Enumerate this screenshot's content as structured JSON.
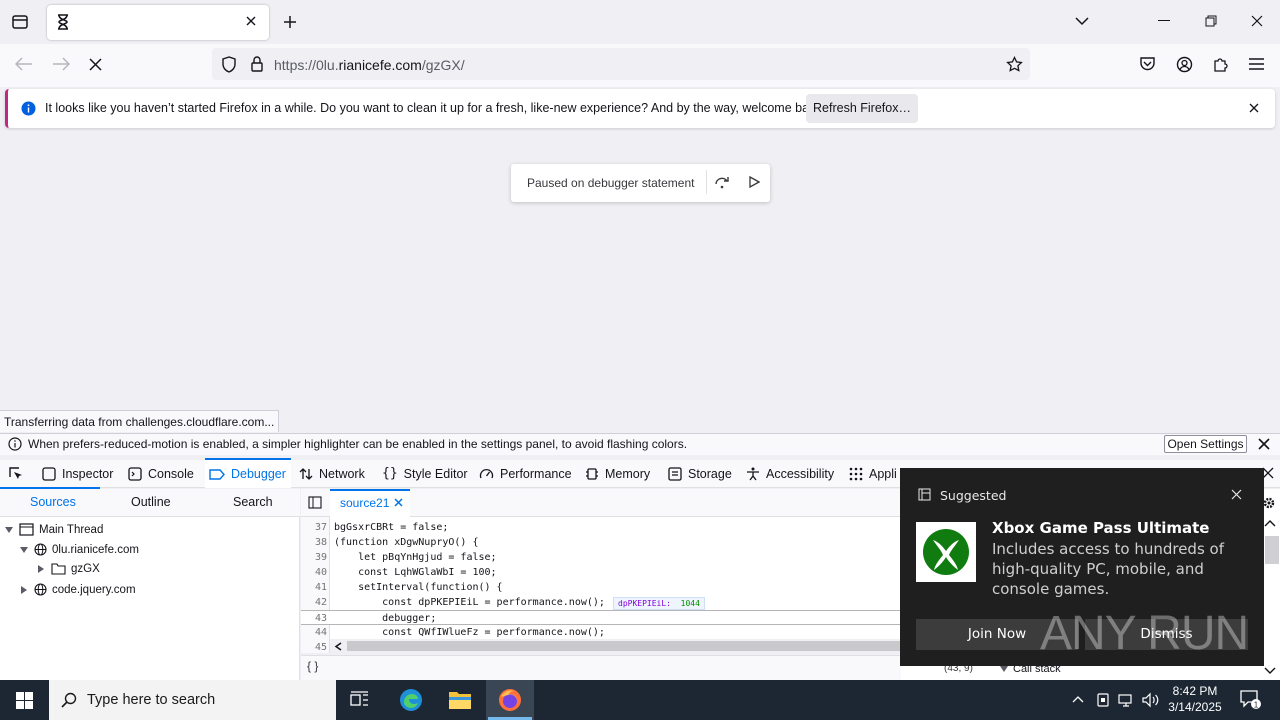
{
  "browser": {
    "tab_title": "",
    "url_prefix": "https://0lu.",
    "url_domain": "rianicefe.com",
    "url_path": "/gzGX/"
  },
  "notification": {
    "message": "It looks like you haven’t started Firefox in a while. Do you want to clean it up for a fresh, like-new experience? And by the way, welcome back!",
    "button": "Refresh Firefox…"
  },
  "content": {
    "paused_message": "Paused on debugger statement",
    "status_text": "Transferring data from challenges.cloudflare.com..."
  },
  "devtools": {
    "info_message": "When prefers-reduced-motion is enabled, a simpler highlighter can be enabled in the settings panel, to avoid flashing colors.",
    "open_settings": "Open Settings",
    "tabs": {
      "inspector": "Inspector",
      "console": "Console",
      "debugger": "Debugger",
      "network": "Network",
      "style_editor": "Style Editor",
      "performance": "Performance",
      "memory": "Memory",
      "storage": "Storage",
      "accessibility": "Accessibility",
      "application": "Appli"
    },
    "left_tabs": {
      "sources": "Sources",
      "outline": "Outline",
      "search": "Search"
    },
    "tree": {
      "main_thread": "Main Thread",
      "domain": "0lu.rianicefe.com",
      "folder": "gzGX",
      "jquery": "code.jquery.com"
    },
    "source_tab": "source21",
    "code": [
      {
        "ln": "37",
        "text": "bgGsxrCBRt = false;"
      },
      {
        "ln": "38",
        "text": "(function xDgwNupryO() {"
      },
      {
        "ln": "39",
        "text": "    let pBqYnHgjud = false;"
      },
      {
        "ln": "40",
        "text": "    const LqhWGlaWbI = 100;"
      },
      {
        "ln": "41",
        "text": "    setInterval(function() {"
      },
      {
        "ln": "42",
        "text": "        const dpPKEPIEiL = performance.now();"
      },
      {
        "ln": "43",
        "text": "        debugger;"
      },
      {
        "ln": "44",
        "text": "        const QWfIWlueFz = performance.now();"
      },
      {
        "ln": "45",
        "text": ""
      }
    ],
    "inline_preview_name": "dpPKEPIEiL:",
    "inline_preview_value": "1044",
    "editor_footer": "{ }",
    "cursor_position": "(43, 9)",
    "call_stack_label": "Call stack"
  },
  "toast": {
    "header": "Suggested",
    "title": "Xbox Game Pass Ultimate",
    "body": "Includes access to hundreds of high-quality PC, mobile, and console games.",
    "join": "Join Now",
    "dismiss": "Dismiss",
    "watermark": "ANY RUN"
  },
  "taskbar": {
    "search_placeholder": "Type here to search",
    "time": "8:42 PM",
    "date": "3/14/2025"
  },
  "colors": {
    "accent": "#0074e8",
    "toast_bg": "#1f1f1f",
    "taskbar_bg": "#1c2733",
    "xbox_green": "#107c10"
  }
}
